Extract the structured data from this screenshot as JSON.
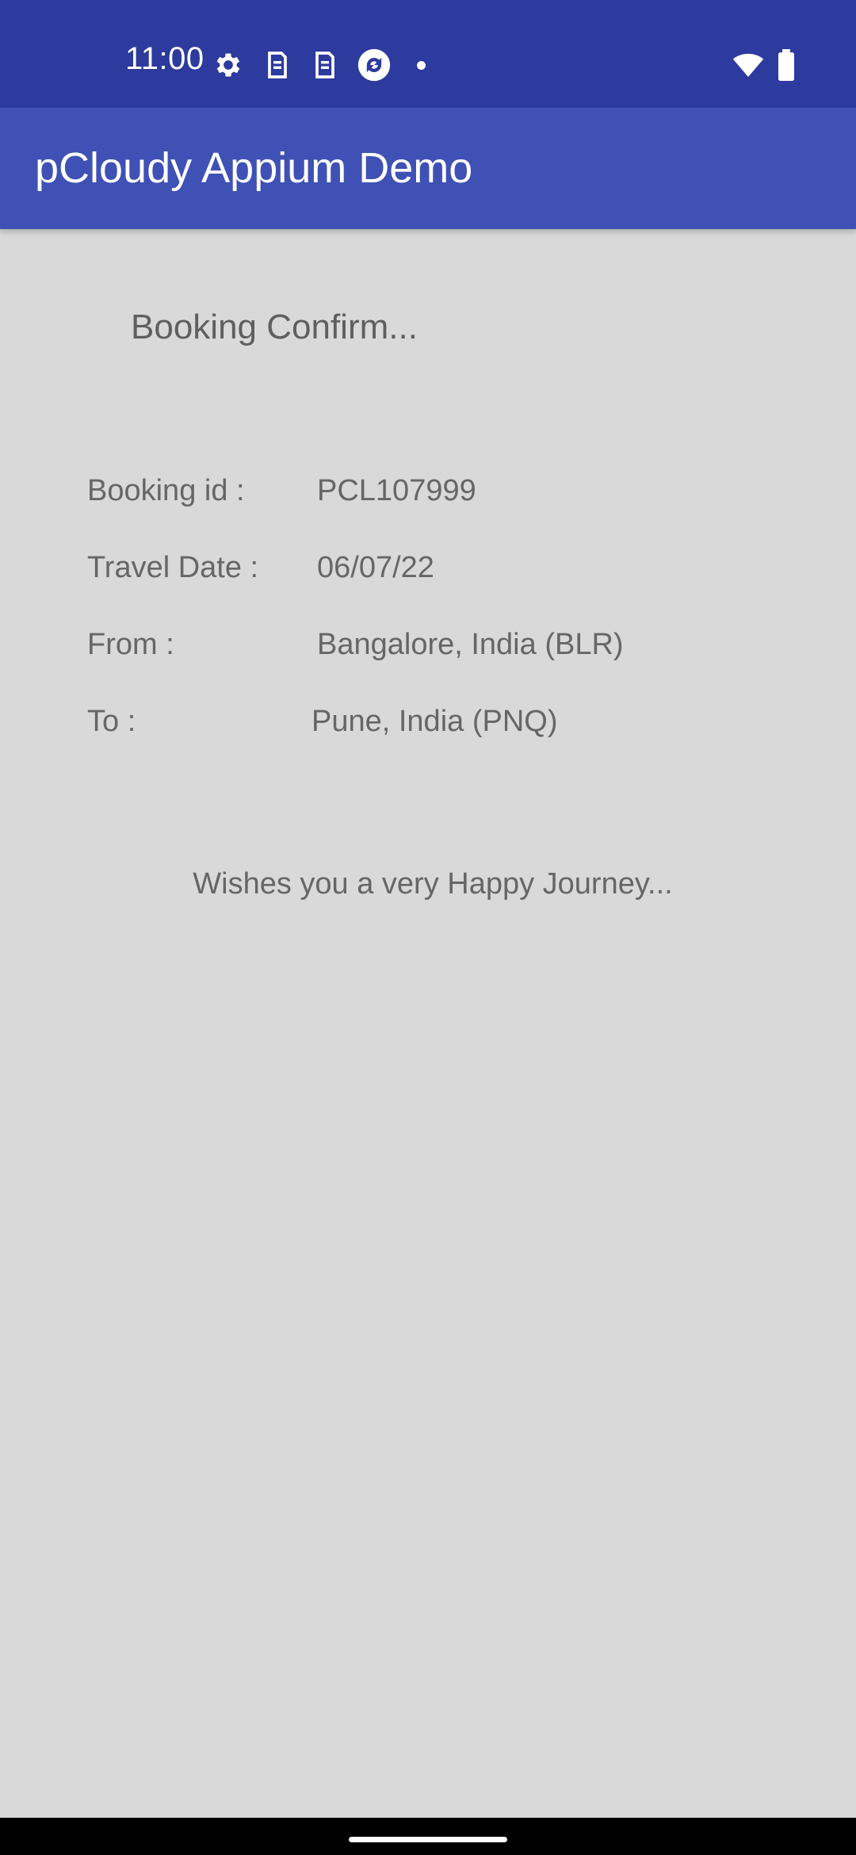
{
  "status_bar": {
    "time": "11:00",
    "icons": [
      "gear-icon",
      "sim-card-icon",
      "sim-card-icon",
      "sync-app-icon",
      "notification-dot-icon",
      "wifi-icon",
      "battery-icon"
    ]
  },
  "app_bar": {
    "title": "pCloudy Appium Demo"
  },
  "booking": {
    "heading": "Booking Confirm...",
    "rows": [
      {
        "label": "Booking id :",
        "value": "PCL107999"
      },
      {
        "label": "Travel Date :",
        "value": "06/07/22"
      },
      {
        "label": "From :",
        "value": "Bangalore, India (BLR)"
      },
      {
        "label": "To :",
        "value": "Pune, India (PNQ)"
      }
    ],
    "message": "Wishes you a very Happy Journey..."
  },
  "colors": {
    "status_bar": "#2d3a9e",
    "app_bar": "#3f51b5",
    "background": "#d9d9d9",
    "text": "#666666"
  }
}
